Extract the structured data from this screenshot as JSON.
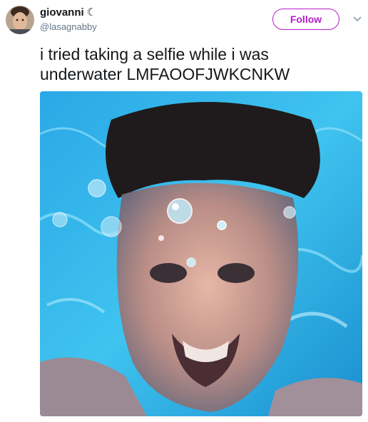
{
  "author": {
    "display_name": "giovanni",
    "name_emoji": "☾",
    "handle": "@lasagnabby"
  },
  "actions": {
    "follow_label": "Follow",
    "more_icon": "chevron-down-icon"
  },
  "tweet": {
    "text": "i tried taking a selfie while i was\nunderwater LMFAOOFJWKCNKW"
  },
  "media": {
    "description_icon": "photo"
  },
  "colors": {
    "follow_accent": "#b41ec8",
    "handle_gray": "#657786",
    "water_blue": "#1fa9e0"
  }
}
